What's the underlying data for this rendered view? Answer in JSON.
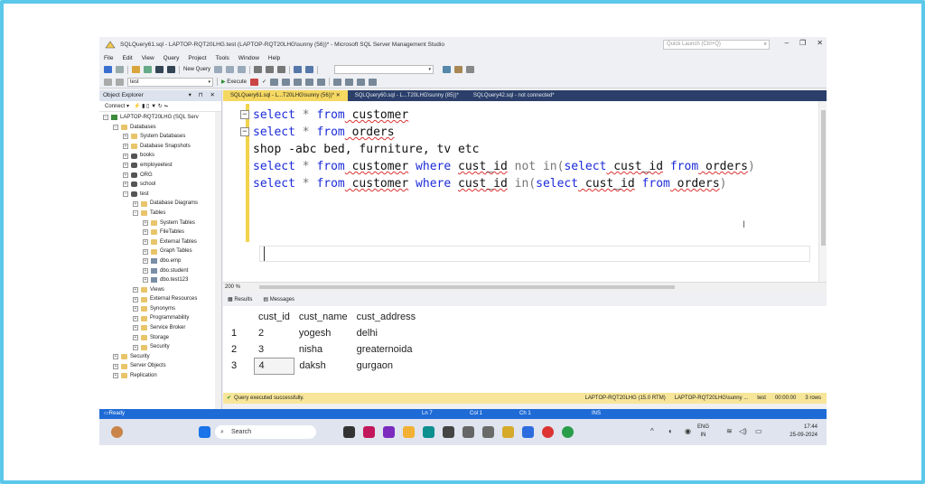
{
  "window": {
    "title": "SQLQuery61.sql - LAPTOP-RQT20LHG.test (LAPTOP-RQT20LHG\\sunny (56))* - Microsoft SQL Server Management Studio",
    "quick_launch": "Quick Launch (Ctrl+Q)"
  },
  "menu": [
    "File",
    "Edit",
    "View",
    "Query",
    "Project",
    "Tools",
    "Window",
    "Help"
  ],
  "toolbar": {
    "new_query": "New Query",
    "database": "test",
    "execute": "Execute"
  },
  "object_explorer": {
    "title": "Object Explorer",
    "connect": "Connect ▾",
    "tree": [
      {
        "label": "LAPTOP-RQT20LHG (SQL Serv",
        "indent": 0,
        "icon": "server",
        "exp": "−"
      },
      {
        "label": "Databases",
        "indent": 1,
        "icon": "folder",
        "exp": "−"
      },
      {
        "label": "System Databases",
        "indent": 2,
        "icon": "folder",
        "exp": "+"
      },
      {
        "label": "Database Snapshots",
        "indent": 2,
        "icon": "folder",
        "exp": "+"
      },
      {
        "label": "books",
        "indent": 2,
        "icon": "db",
        "exp": "+"
      },
      {
        "label": "employeetest",
        "indent": 2,
        "icon": "db",
        "exp": "+"
      },
      {
        "label": "ORG",
        "indent": 2,
        "icon": "db",
        "exp": "+"
      },
      {
        "label": "school",
        "indent": 2,
        "icon": "db",
        "exp": "+"
      },
      {
        "label": "test",
        "indent": 2,
        "icon": "db",
        "exp": "−"
      },
      {
        "label": "Database Diagrams",
        "indent": 3,
        "icon": "folder",
        "exp": "+"
      },
      {
        "label": "Tables",
        "indent": 3,
        "icon": "folder",
        "exp": "−"
      },
      {
        "label": "System Tables",
        "indent": 4,
        "icon": "folder",
        "exp": "+"
      },
      {
        "label": "FileTables",
        "indent": 4,
        "icon": "folder",
        "exp": "+"
      },
      {
        "label": "External Tables",
        "indent": 4,
        "icon": "folder",
        "exp": "+"
      },
      {
        "label": "Graph Tables",
        "indent": 4,
        "icon": "folder",
        "exp": "+"
      },
      {
        "label": "dbo.emp",
        "indent": 4,
        "icon": "table",
        "exp": "+"
      },
      {
        "label": "dbo.student",
        "indent": 4,
        "icon": "table",
        "exp": "+"
      },
      {
        "label": "dbo.test123",
        "indent": 4,
        "icon": "table",
        "exp": "+"
      },
      {
        "label": "Views",
        "indent": 3,
        "icon": "folder",
        "exp": "+"
      },
      {
        "label": "External Resources",
        "indent": 3,
        "icon": "folder",
        "exp": "+"
      },
      {
        "label": "Synonyms",
        "indent": 3,
        "icon": "folder",
        "exp": "+"
      },
      {
        "label": "Programmability",
        "indent": 3,
        "icon": "folder",
        "exp": "+"
      },
      {
        "label": "Service Broker",
        "indent": 3,
        "icon": "folder",
        "exp": "+"
      },
      {
        "label": "Storage",
        "indent": 3,
        "icon": "folder",
        "exp": "+"
      },
      {
        "label": "Security",
        "indent": 3,
        "icon": "folder",
        "exp": "+"
      },
      {
        "label": "Security",
        "indent": 1,
        "icon": "folder",
        "exp": "+"
      },
      {
        "label": "Server Objects",
        "indent": 1,
        "icon": "folder",
        "exp": "+"
      },
      {
        "label": "Replication",
        "indent": 1,
        "icon": "folder",
        "exp": "+"
      }
    ]
  },
  "tabs": [
    {
      "label": "SQLQuery61.sql - L...T20LHG\\sunny (56))*  ✕",
      "active": true
    },
    {
      "label": "SQLQuery60.sql - L...T20LHG\\sunny (85))*",
      "active": false
    },
    {
      "label": "SQLQuery42.sql - not connected*",
      "active": false
    }
  ],
  "editor": {
    "zoom": "200 %",
    "lines": [
      {
        "parts": [
          [
            "kw",
            "select"
          ],
          [
            "gr",
            " * "
          ],
          [
            "kw",
            "from"
          ],
          [
            "",
            ""
          ],
          [
            "sq",
            " customer"
          ]
        ],
        "fold": true
      },
      {
        "parts": [
          [
            "kw",
            "select"
          ],
          [
            "gr",
            " * "
          ],
          [
            "kw",
            "from"
          ],
          [
            "sq",
            " orders"
          ]
        ],
        "fold": true
      },
      {
        "parts": [
          [
            "",
            "shop -abc bed, furniture, tv etc"
          ]
        ],
        "fold": false
      },
      {
        "parts": [
          [
            "kw",
            "select"
          ],
          [
            "gr",
            " * "
          ],
          [
            "kw",
            "from"
          ],
          [
            "sq",
            " customer"
          ],
          [
            "kw",
            " where "
          ],
          [
            "sq",
            "cust_id"
          ],
          [
            "gr",
            " not in("
          ],
          [
            "kw",
            "select"
          ],
          [
            "sq",
            " cust_id"
          ],
          [
            "kw",
            " from"
          ],
          [
            "sq",
            " orders"
          ],
          [
            "gr",
            ")"
          ]
        ],
        "fold": false
      },
      {
        "parts": [
          [
            "kw",
            "select"
          ],
          [
            "gr",
            " * "
          ],
          [
            "kw",
            "from"
          ],
          [
            "sq",
            " customer"
          ],
          [
            "kw",
            " where "
          ],
          [
            "sq",
            "cust_id"
          ],
          [
            "gr",
            " in("
          ],
          [
            "kw",
            "select"
          ],
          [
            "sq",
            " cust_id"
          ],
          [
            "kw",
            " from"
          ],
          [
            "sq",
            " orders"
          ],
          [
            "gr",
            ")"
          ]
        ],
        "fold": false
      }
    ]
  },
  "results": {
    "tab_results": "Results",
    "tab_messages": "Messages",
    "columns": [
      "cust_id",
      "cust_name",
      "cust_address"
    ],
    "rows": [
      [
        "1",
        "2",
        "yogesh",
        "delhi"
      ],
      [
        "2",
        "3",
        "nisha",
        "greaternoida"
      ],
      [
        "3",
        "4",
        "daksh",
        "gurgaon"
      ]
    ]
  },
  "query_status": {
    "message": "Query executed successfully.",
    "server": "LAPTOP-RQT20LHG (15.0 RTM)",
    "user": "LAPTOP-RQT20LHG\\sunny ...",
    "db": "test",
    "time": "00:00:00",
    "rows": "3 rows"
  },
  "statusbar": {
    "ready": "Ready",
    "ln": "Ln 7",
    "col": "Col 1",
    "ch": "Ch 1",
    "ins": "INS"
  },
  "taskbar": {
    "search": "Search",
    "lang": "ENG",
    "region": "IN",
    "time": "17:44",
    "date": "25-09-2024"
  }
}
